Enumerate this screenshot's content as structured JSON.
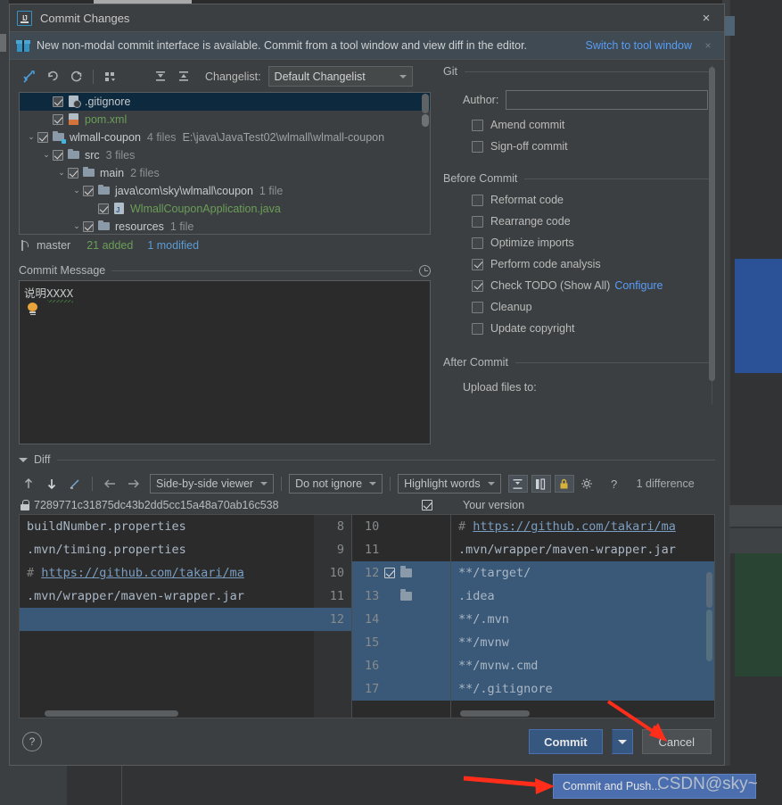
{
  "window": {
    "title": "Commit Changes",
    "logo": "intellij-idea-logo",
    "close": "×"
  },
  "notification": {
    "icon": "gift-icon",
    "text": "New non-modal commit interface is available. Commit from a tool window and view diff in the editor.",
    "link": "Switch to tool window",
    "close": "×"
  },
  "toolbar": {
    "icons": [
      "show-diff-icon",
      "revert-icon",
      "refresh-icon",
      "group-by-icon",
      "expand-all-icon",
      "collapse-all-icon"
    ],
    "changelist_label": "Changelist:",
    "changelist_value": "Default Changelist"
  },
  "tree": {
    "rows": [
      {
        "indent": 1,
        "chevron": "",
        "checked": true,
        "icon": "gitignore-file-icon",
        "name": ".gitignore",
        "color": "plain",
        "meta": "",
        "meta2": "",
        "selected": true
      },
      {
        "indent": 1,
        "chevron": "",
        "checked": true,
        "icon": "xml-file-icon",
        "name": "pom.xml",
        "color": "green",
        "meta": "",
        "meta2": "",
        "selected": false
      },
      {
        "indent": 0,
        "chevron": "⌄",
        "checked": true,
        "icon": "module-folder-icon",
        "name": "wlmall-coupon",
        "color": "plain",
        "meta": "4 files",
        "meta2": "E:\\java\\JavaTest02\\wlmall\\wlmall-coupon",
        "selected": false
      },
      {
        "indent": 1,
        "chevron": "⌄",
        "checked": true,
        "icon": "folder-icon",
        "name": "src",
        "color": "plain",
        "meta": "3 files",
        "meta2": "",
        "selected": false
      },
      {
        "indent": 2,
        "chevron": "⌄",
        "checked": true,
        "icon": "folder-icon",
        "name": "main",
        "color": "plain",
        "meta": "2 files",
        "meta2": "",
        "selected": false
      },
      {
        "indent": 3,
        "chevron": "⌄",
        "checked": true,
        "icon": "folder-icon",
        "name": "java\\com\\sky\\wlmall\\coupon",
        "color": "plain",
        "meta": "1 file",
        "meta2": "",
        "selected": false
      },
      {
        "indent": 4,
        "chevron": "",
        "checked": true,
        "icon": "java-file-icon",
        "name": "WlmallCouponApplication.java",
        "color": "green",
        "meta": "",
        "meta2": "",
        "selected": false
      },
      {
        "indent": 3,
        "chevron": "⌄",
        "checked": true,
        "icon": "folder-icon",
        "name": "resources",
        "color": "plain",
        "meta": "1 file",
        "meta2": "",
        "selected": false
      }
    ]
  },
  "status": {
    "branch_icon": "git-branch-icon",
    "branch": "master",
    "added": "21 added",
    "modified": "1 modified"
  },
  "commit_message": {
    "section_title": "Commit Message",
    "history_icon": "history-clock-icon",
    "value": "说明XXXX",
    "hint_icon": "lightbulb-icon"
  },
  "git_section": {
    "title": "Git",
    "author_label": "Author:",
    "author_value": "",
    "checkboxes": [
      {
        "label": "Amend commit",
        "checked": false,
        "name": "amend-commit"
      },
      {
        "label": "Sign-off commit",
        "checked": false,
        "name": "sign-off-commit"
      }
    ]
  },
  "before_commit": {
    "title": "Before Commit",
    "checkboxes": [
      {
        "label": "Reformat code",
        "checked": false,
        "name": "reformat-code"
      },
      {
        "label": "Rearrange code",
        "checked": false,
        "name": "rearrange-code"
      },
      {
        "label": "Optimize imports",
        "checked": false,
        "name": "optimize-imports"
      },
      {
        "label": "Perform code analysis",
        "checked": true,
        "name": "perform-code-analysis"
      },
      {
        "label": "Check TODO (Show All)",
        "checked": true,
        "name": "check-todo",
        "link": "Configure"
      },
      {
        "label": "Cleanup",
        "checked": false,
        "name": "cleanup"
      },
      {
        "label": "Update copyright",
        "checked": false,
        "name": "update-copyright"
      }
    ]
  },
  "after_commit": {
    "title": "After Commit",
    "upload_label": "Upload files to:"
  },
  "diff": {
    "section_title": "Diff",
    "toolbar_icons": [
      "prev-diff-up-icon",
      "next-diff-down-icon",
      "edit-pencil-icon",
      "arrow-left-icon",
      "arrow-right-icon"
    ],
    "viewer_mode": "Side-by-side viewer",
    "ignore_mode": "Do not ignore",
    "highlight_mode": "Highlight words",
    "extra_icons": [
      "collapse-unchanged-icon",
      "align-columns-icon",
      "lock-icon",
      "settings-gear-icon",
      "help-question-icon"
    ],
    "difference_count": "1 difference",
    "left_header": {
      "icon": "lock-icon",
      "text": "7289771c31875dc43b2dd5cc15a48a70ab16c538"
    },
    "right_header": {
      "checkbox": true,
      "text": "Your version"
    },
    "left_lines": [
      {
        "num": "8",
        "text": "buildNumber.properties",
        "type": "plain",
        "highlight": false
      },
      {
        "num": "9",
        "text": ".mvn/timing.properties",
        "type": "plain",
        "highlight": false
      },
      {
        "num": "10",
        "text": "# https://github.com/takari/ma",
        "type": "comment-link",
        "highlight": false
      },
      {
        "num": "11",
        "text": ".mvn/wrapper/maven-wrapper.jar",
        "type": "plain",
        "highlight": false
      },
      {
        "num": "12",
        "text": "",
        "type": "plain",
        "highlight": true
      }
    ],
    "right_lines": [
      {
        "num": "10",
        "text": "# https://github.com/takari/ma",
        "type": "comment-link",
        "highlight": false,
        "gutter": ""
      },
      {
        "num": "11",
        "text": ".mvn/wrapper/maven-wrapper.jar",
        "type": "plain",
        "highlight": false,
        "gutter": ""
      },
      {
        "num": "12",
        "text": "**/target/",
        "type": "plain",
        "highlight": true,
        "gutter": "checkbox-folder"
      },
      {
        "num": "13",
        "text": ".idea",
        "type": "plain",
        "highlight": true,
        "gutter": "folder"
      },
      {
        "num": "14",
        "text": "**/.mvn",
        "type": "plain",
        "highlight": true,
        "gutter": ""
      },
      {
        "num": "15",
        "text": "**/mvnw",
        "type": "plain",
        "highlight": true,
        "gutter": ""
      },
      {
        "num": "16",
        "text": "**/mvnw.cmd",
        "type": "plain",
        "highlight": true,
        "gutter": ""
      },
      {
        "num": "17",
        "text": "**/.gitignore",
        "type": "plain",
        "highlight": true,
        "gutter": ""
      }
    ]
  },
  "footer": {
    "help": "?",
    "commit": "Commit",
    "commit_dropdown": "▼",
    "cancel": "Cancel"
  },
  "popup_menu": {
    "item": "Commit and Push..."
  },
  "watermark": "CSDN@sky~",
  "colors": {
    "accent_blue": "#365880",
    "link_blue": "#589df6",
    "added_green": "#6a9e58",
    "modified_blue": "#5b9bd5",
    "diff_highlight": "#3a5877",
    "annotation_red": "#ff2d1a"
  }
}
